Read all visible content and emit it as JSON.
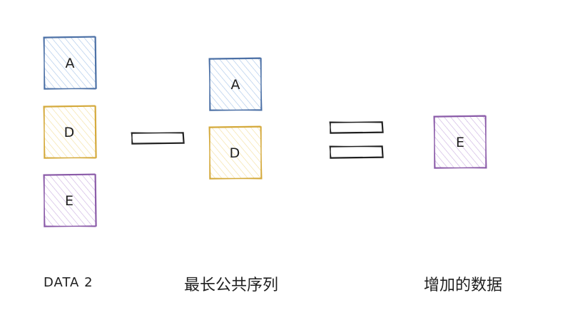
{
  "colors": {
    "blue_stroke": "#4a6fa5",
    "blue_hatch": "#a5c3e8",
    "yellow_stroke": "#d4a93a",
    "yellow_hatch": "#f3de9a",
    "purple_stroke": "#8a5aa8",
    "purple_hatch": "#c9aee0",
    "ink": "#1e1e1e"
  },
  "left_column": {
    "boxes": [
      {
        "letter": "A",
        "color": "blue"
      },
      {
        "letter": "D",
        "color": "yellow"
      },
      {
        "letter": "E",
        "color": "purple"
      }
    ],
    "caption": "DATA 2"
  },
  "operator_minus": "minus-sign",
  "middle_column": {
    "boxes": [
      {
        "letter": "A",
        "color": "blue"
      },
      {
        "letter": "D",
        "color": "yellow"
      }
    ],
    "caption": "最长公共序列"
  },
  "operator_equals": "equals-sign",
  "right_column": {
    "boxes": [
      {
        "letter": "E",
        "color": "purple"
      }
    ],
    "caption": "增加的数据"
  }
}
